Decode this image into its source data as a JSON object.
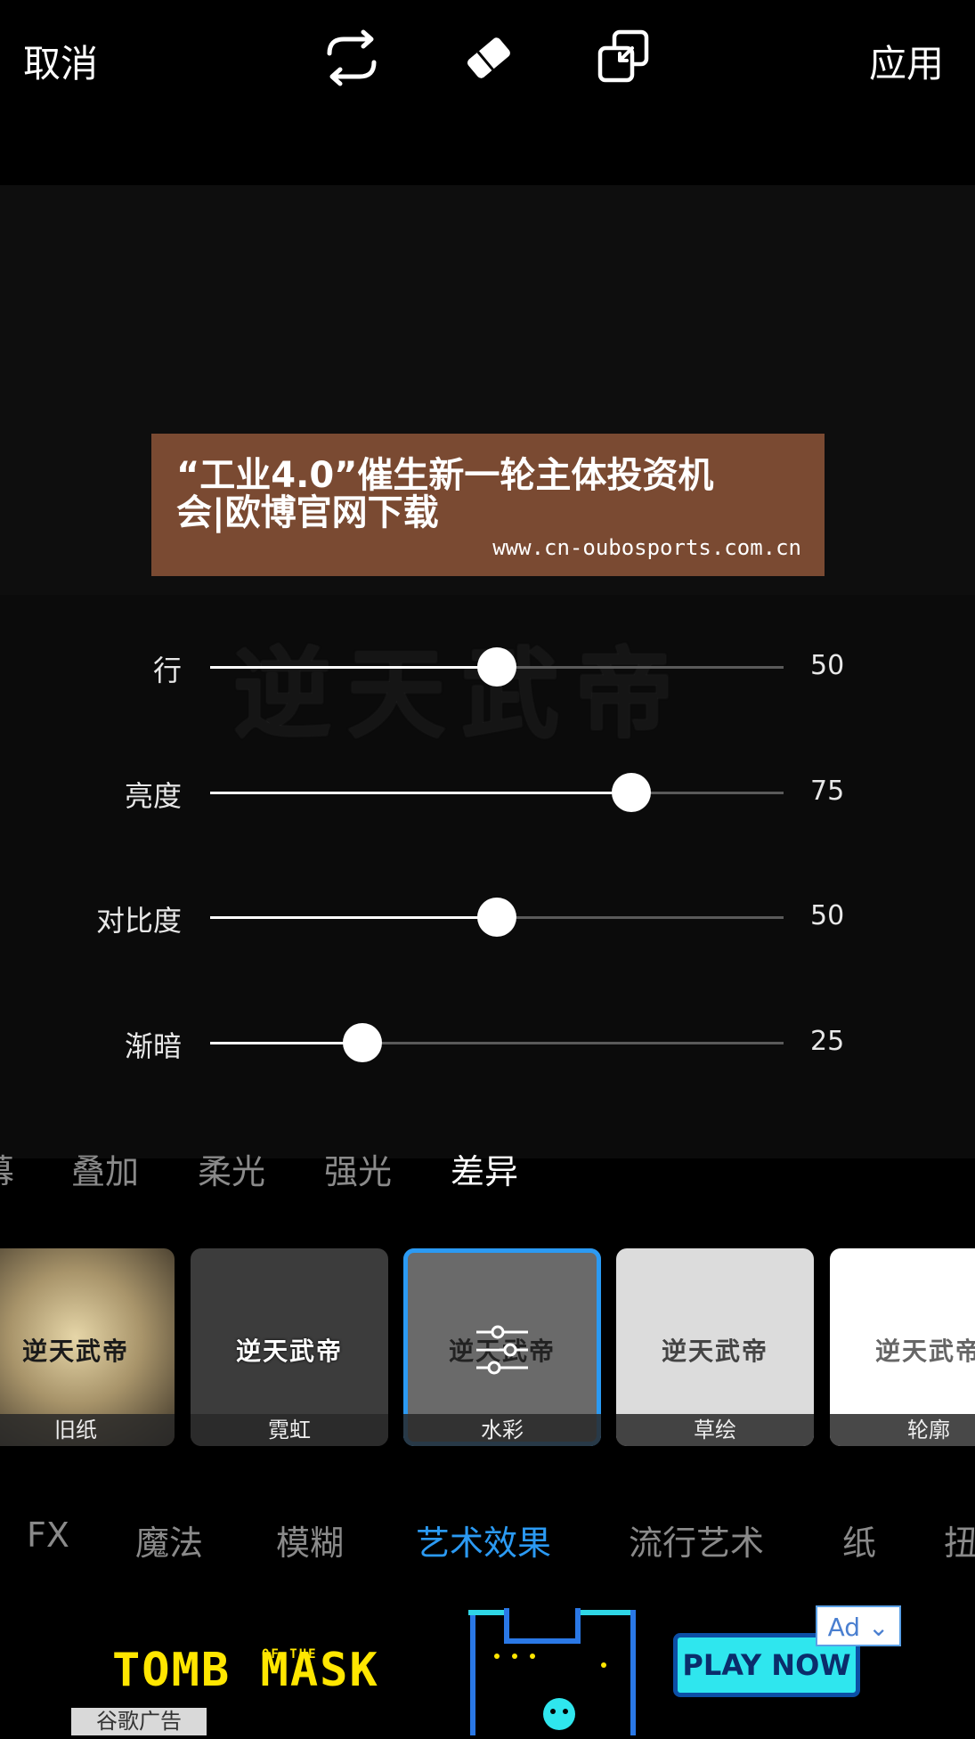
{
  "topbar": {
    "cancel": "取消",
    "apply": "应用",
    "icons": [
      "repeat-icon",
      "eraser-icon",
      "compare-icon"
    ]
  },
  "banner": {
    "line1": "“工业4.0”催生新一轮主体投资机",
    "line2": "会|欧博官网下载",
    "url": "www.cn-oubosports.com.cn"
  },
  "watermark": "逆天武帝",
  "sliders": [
    {
      "label": "行",
      "value": "50",
      "fraction": 0.5
    },
    {
      "label": "亮度",
      "value": "75",
      "fraction": 0.735
    },
    {
      "label": "对比度",
      "value": "50",
      "fraction": 0.5
    },
    {
      "label": "渐暗",
      "value": "25",
      "fraction": 0.265
    }
  ],
  "blend_modes": [
    "幕",
    "叠加",
    "柔光",
    "强光",
    "差异"
  ],
  "blend_active": "差异",
  "effects": [
    {
      "label": "旧纸",
      "sample": "逆天武帝",
      "selected": false
    },
    {
      "label": "霓虹",
      "sample": "逆天武帝",
      "selected": false
    },
    {
      "label": "水彩",
      "sample": "逆天武帝",
      "selected": true
    },
    {
      "label": "草绘",
      "sample": "逆天武帝",
      "selected": false
    },
    {
      "label": "轮廓",
      "sample": "逆天武帝",
      "selected": false
    }
  ],
  "categories": [
    "FX",
    "魔法",
    "模糊",
    "艺术效果",
    "流行艺术",
    "纸",
    "扭"
  ],
  "category_active": "艺术效果",
  "ad": {
    "logo": "TOMB MASK",
    "logo_small": "OF THE",
    "play": "PLAY NOW",
    "badge": "Ad",
    "google": "谷歌广告"
  },
  "colors": {
    "accent": "#2b9af3",
    "banner": "#7a4a32",
    "ad_yellow": "#ffe600",
    "ad_cyan": "#2fe6ee"
  }
}
